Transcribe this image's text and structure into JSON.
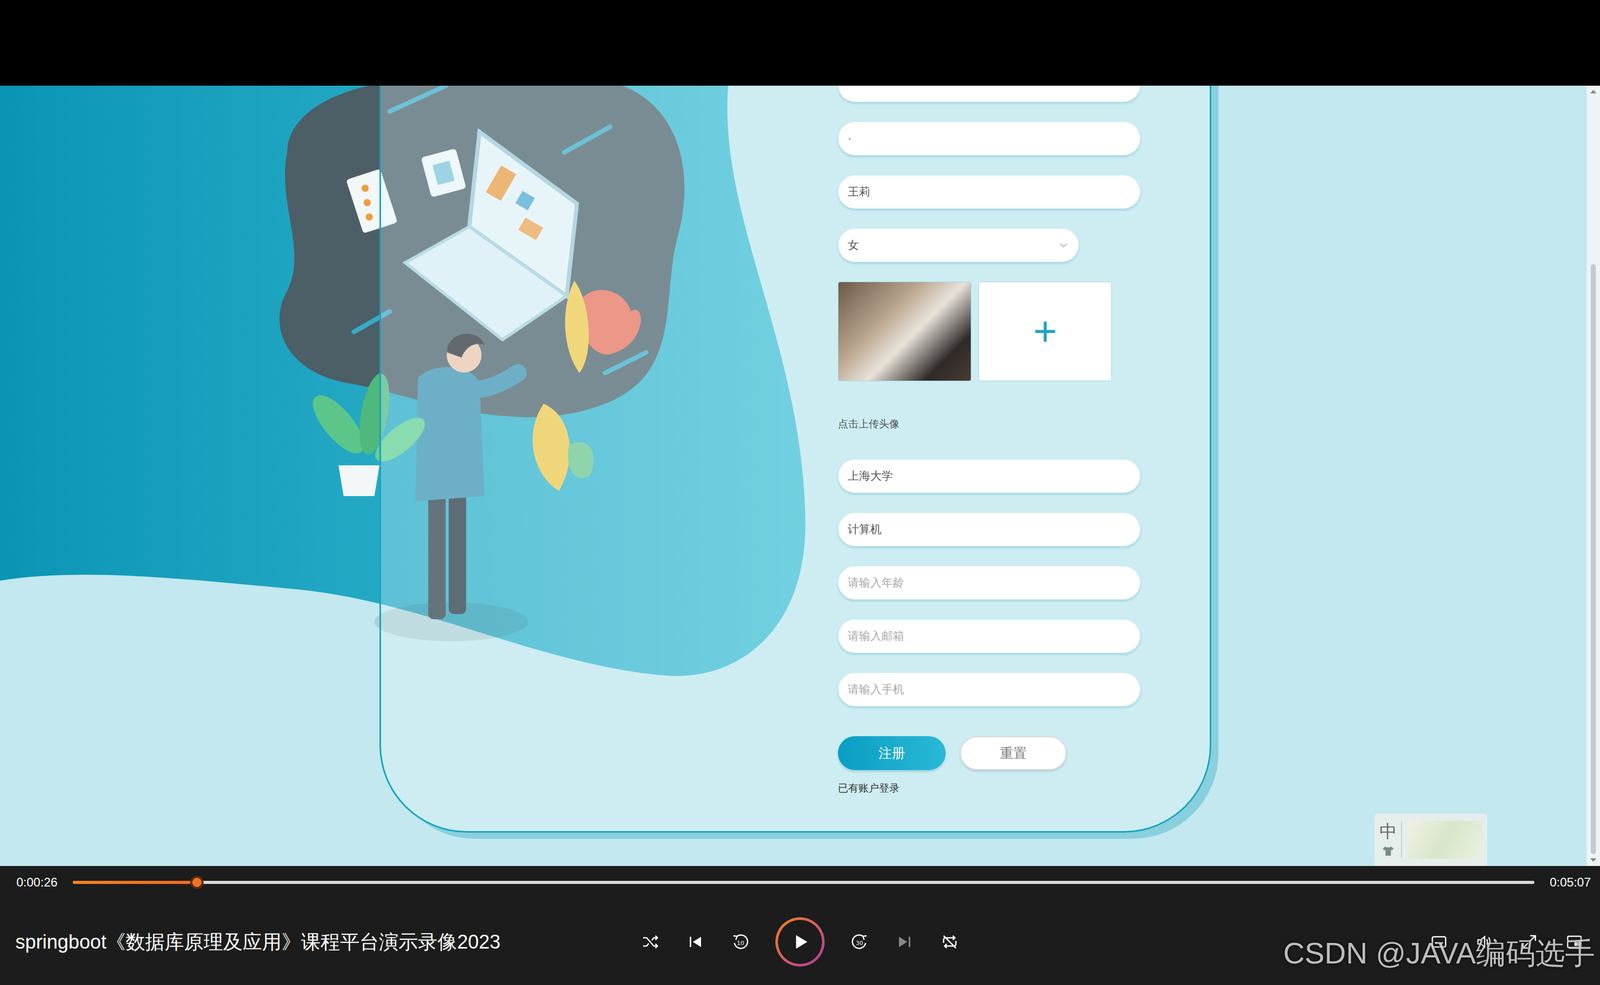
{
  "player": {
    "title": "springboot《数据库原理及应用》课程平台演示录像2023",
    "current_time": "0:00:26",
    "total_time": "0:05:07",
    "progress": {
      "level": 0.085
    },
    "playing": false,
    "skip_back": "10",
    "skip_forward": "30"
  },
  "page": {
    "fields": [
      {
        "kind": "input",
        "value": "",
        "placeholder": ""
      },
      {
        "kind": "input",
        "value": "·",
        "placeholder": ""
      },
      {
        "kind": "input",
        "value": "王莉",
        "placeholder": ""
      },
      {
        "kind": "select",
        "value": "女",
        "placeholder": ""
      },
      {
        "kind": "upload",
        "value": "",
        "placeholder": "",
        "add": "+",
        "hint": "点击上传头像"
      },
      {
        "kind": "input",
        "value": "上海大学",
        "placeholder": ""
      },
      {
        "kind": "input",
        "value": "计算机",
        "placeholder": ""
      },
      {
        "kind": "input",
        "value": "",
        "placeholder": "请输入年龄"
      },
      {
        "kind": "input",
        "value": "",
        "placeholder": "请输入邮箱"
      },
      {
        "kind": "input",
        "value": "",
        "placeholder": "请输入手机"
      }
    ],
    "buttons": [
      {
        "label": "注册",
        "primary": true
      },
      {
        "label": "重置",
        "primary": false
      }
    ],
    "login_link": "已有账户登录"
  },
  "ime": {
    "mode": "中"
  },
  "scrollbar": {
    "level": 0.78
  },
  "watermark": "CSDN @JAVA编码选手"
}
